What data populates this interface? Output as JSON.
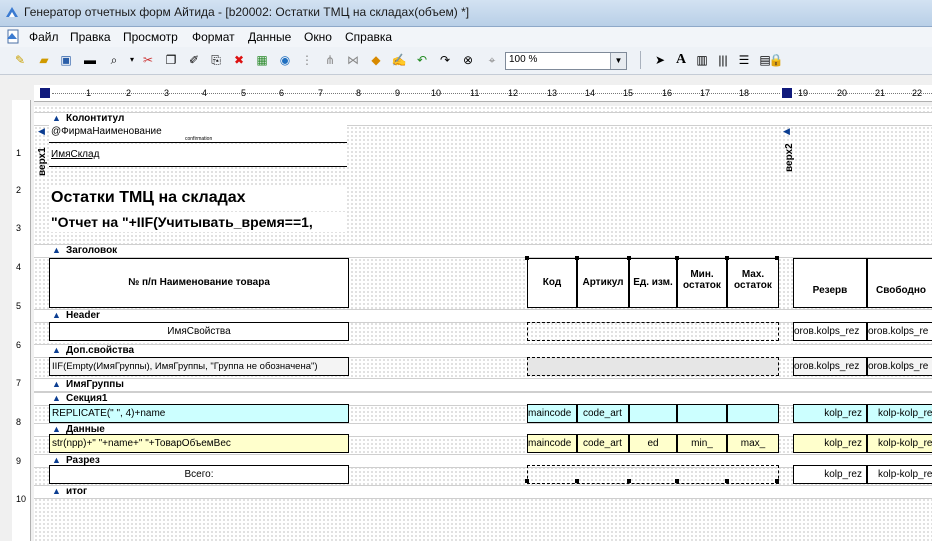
{
  "window": {
    "title": "Генератор отчетных форм Айтида - [b20002: Остатки ТМЦ на складах(объем) *]"
  },
  "menu": [
    "Файл",
    "Правка",
    "Просмотр",
    "Формат",
    "Данные",
    "Окно",
    "Справка"
  ],
  "toolbar": {
    "zoom": "100 %"
  },
  "ruler": {
    "top": [
      "1",
      "2",
      "3",
      "4",
      "5",
      "6",
      "7",
      "8",
      "9",
      "10",
      "11",
      "12",
      "13",
      "14",
      "15",
      "16",
      "17",
      "18",
      "19",
      "20",
      "21",
      "22"
    ],
    "left": [
      "1",
      "2",
      "3",
      "4",
      "5",
      "6",
      "7",
      "8",
      "9",
      "10"
    ]
  },
  "bands": {
    "kolontitul": "Колонтитул",
    "zagolovok": "Заголовок",
    "header": "Header",
    "dopsvoistva": "Доп.свойства",
    "imyagruppy": "ИмяГруппы",
    "sekciya1": "Секция1",
    "dannye": "Данные",
    "razrez": "Разрез",
    "itog": "итог"
  },
  "page_labels": {
    "verh1": "верх1",
    "verh2": "верх2"
  },
  "kolontitul": {
    "firm": "@ФирмаНаименование",
    "small": "confirmation",
    "sklad": "ИмяСклад",
    "title": "Остатки ТМЦ на складах",
    "report_on": "\"Отчет на \"+IIF(Учитывать_время==1,"
  },
  "zagolovok": {
    "col1": "№ п/п Наименование товара",
    "kod": "Код",
    "artikul": "Артикул",
    "ed": "Ед. изм.",
    "min": "Мин. остаток",
    "max": "Мах. остаток",
    "rezerv": "Резерв",
    "svobodno": "Свободно"
  },
  "header": {
    "prop": "ИмяСвойства",
    "r1": "oroв.kolps_rez",
    "r2": "oroв.kolps_re"
  },
  "dop": {
    "expr": "IIF(Empty(ИмяГруппы), ИмяГруппы, \"Группа не обозначена\")",
    "r1": "oroв.kolps_rez",
    "r2": "oroв.kolps_re"
  },
  "sekciya": {
    "expr": "REPLICATE(\" \", 4)+name",
    "maincode": "maincode",
    "code_art": "code_art",
    "r1": "kolp_rez",
    "r2": "kolp-kolp_re"
  },
  "dannye": {
    "expr": "str(npp)+\"  \"+name+\" \"+ТоварОбъемВес",
    "maincode": "maincode",
    "code_art": "code_art",
    "ed": "ed",
    "min": "min_",
    "max": "max_",
    "r1": "kolp_rez",
    "r2": "kolp-kolp_re"
  },
  "razrez": {
    "total": "Всего:",
    "r1": "kolp_rez",
    "r2": "kolp-kolp_re"
  }
}
